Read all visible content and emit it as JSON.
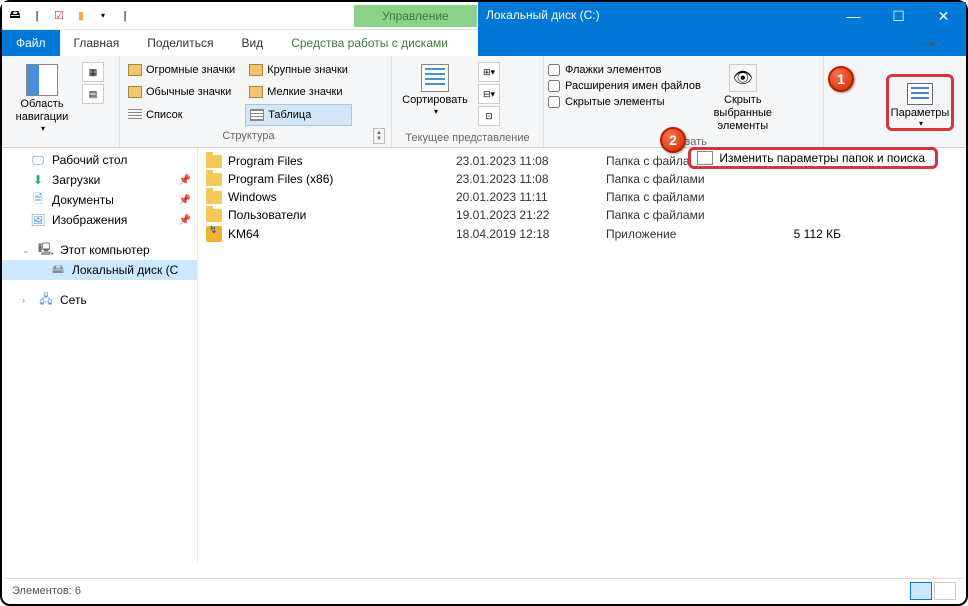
{
  "window": {
    "title": "Локальный диск (C:)",
    "manage_tab": "Управление",
    "manage_sub": "Средства работы с дисками"
  },
  "tabs": {
    "file": "Файл",
    "home": "Главная",
    "share": "Поделиться",
    "view": "Вид"
  },
  "ribbon": {
    "nav_pane": "Область навигации",
    "panes_group": "",
    "layout": {
      "huge": "Огромные значки",
      "large": "Крупные значки",
      "medium": "Обычные значки",
      "small": "Мелкие значки",
      "list": "Список",
      "table": "Таблица",
      "group": "Структура"
    },
    "sort": "Сортировать",
    "current_view_group": "Текущее представление",
    "flags": "Флажки элементов",
    "extensions": "Расширения имен файлов",
    "hidden": "Скрытые элементы",
    "show_group": "Показать",
    "hide": "Скрыть выбранные элементы",
    "params": "Параметры",
    "change_params": "Изменить параметры папок и поиска"
  },
  "sidebar": {
    "desktop": "Рабочий стол",
    "downloads": "Загрузки",
    "documents": "Документы",
    "pictures": "Изображения",
    "this_pc": "Этот компьютер",
    "local_disk": "Локальный диск (C",
    "network": "Сеть"
  },
  "files": [
    {
      "name": "Program Files",
      "date": "23.01.2023 11:08",
      "type": "Папка с файлами",
      "size": "",
      "icon": "folder"
    },
    {
      "name": "Program Files (x86)",
      "date": "23.01.2023 11:08",
      "type": "Папка с файлами",
      "size": "",
      "icon": "folder"
    },
    {
      "name": "Windows",
      "date": "20.01.2023 11:11",
      "type": "Папка с файлами",
      "size": "",
      "icon": "folder"
    },
    {
      "name": "Пользователи",
      "date": "19.01.2023 21:22",
      "type": "Папка с файлами",
      "size": "",
      "icon": "folder"
    },
    {
      "name": "KM64",
      "date": "18.04.2019 12:18",
      "type": "Приложение",
      "size": "5 112 КБ",
      "icon": "app"
    }
  ],
  "status": {
    "count": "Элементов: 6"
  },
  "badges": {
    "one": "1",
    "two": "2"
  }
}
